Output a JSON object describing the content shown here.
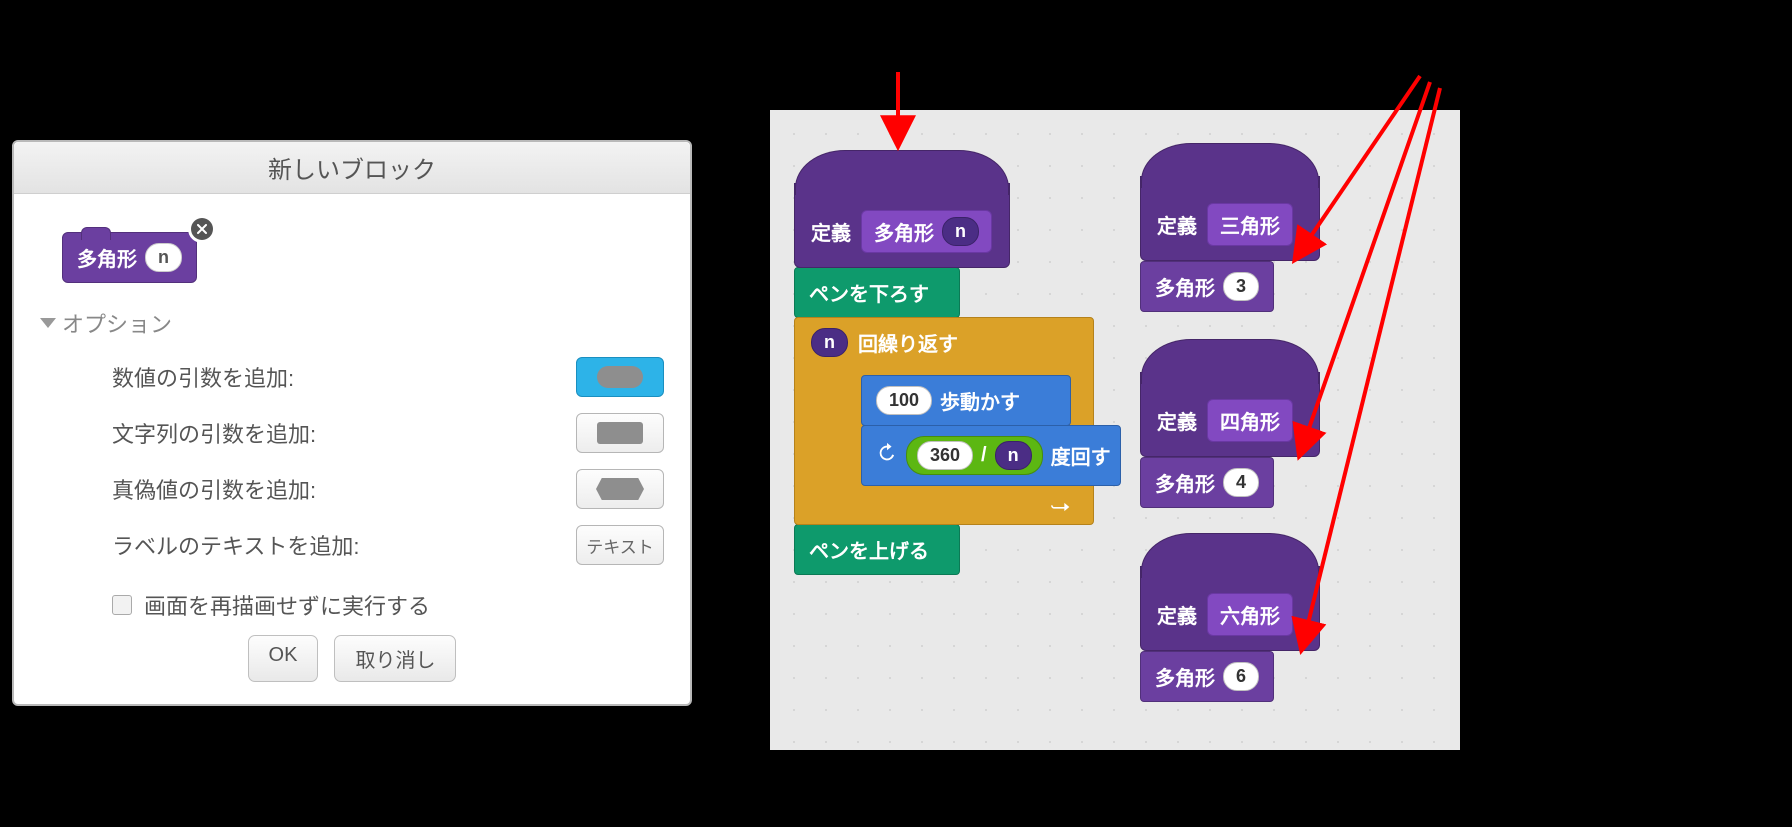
{
  "dialog": {
    "title": "新しいブロック",
    "block_name": "多角形",
    "block_param": "n",
    "options_header": "オプション",
    "opt_number": "数値の引数を追加:",
    "opt_string": "文字列の引数を追加:",
    "opt_bool": "真偽値の引数を追加:",
    "opt_label": "ラベルのテキストを追加:",
    "opt_label_btn": "テキスト",
    "run_without_refresh": "画面を再描画せずに実行する",
    "ok": "OK",
    "cancel": "取り消し"
  },
  "scripts": {
    "define_word": "定義",
    "polygon_name": "多角形",
    "polygon_param": "n",
    "pen_down": "ペンを下ろす",
    "pen_up": "ペンを上げる",
    "repeat_suffix": "回繰り返す",
    "move_steps_value": "100",
    "move_steps_label": "歩動かす",
    "turn_label": "度回す",
    "turn_numerator": "360",
    "turn_op": "/",
    "triangle": {
      "name": "三角形",
      "call_name": "多角形",
      "arg": "3"
    },
    "square": {
      "name": "四角形",
      "call_name": "多角形",
      "arg": "4"
    },
    "hexagon": {
      "name": "六角形",
      "call_name": "多角形",
      "arg": "6"
    }
  }
}
